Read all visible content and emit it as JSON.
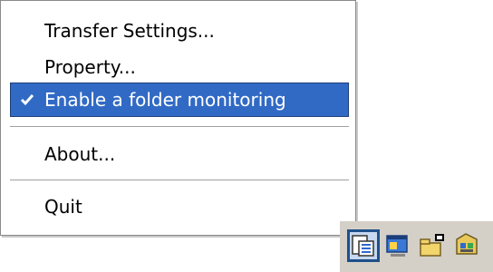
{
  "context_menu": {
    "items": [
      {
        "label": "Transfer Settings..."
      },
      {
        "label": "Property..."
      },
      {
        "label": "Enable a folder monitoring",
        "checked": true,
        "highlighted": true
      },
      {
        "label": "About..."
      },
      {
        "label": "Quit"
      }
    ]
  },
  "tray": {
    "icons": [
      "file-transfer-icon",
      "monitor-window-icon",
      "network-folder-icon",
      "drive-icon"
    ]
  },
  "colors": {
    "highlight": "#316ac5",
    "taskbar": "#d4d0c8"
  }
}
